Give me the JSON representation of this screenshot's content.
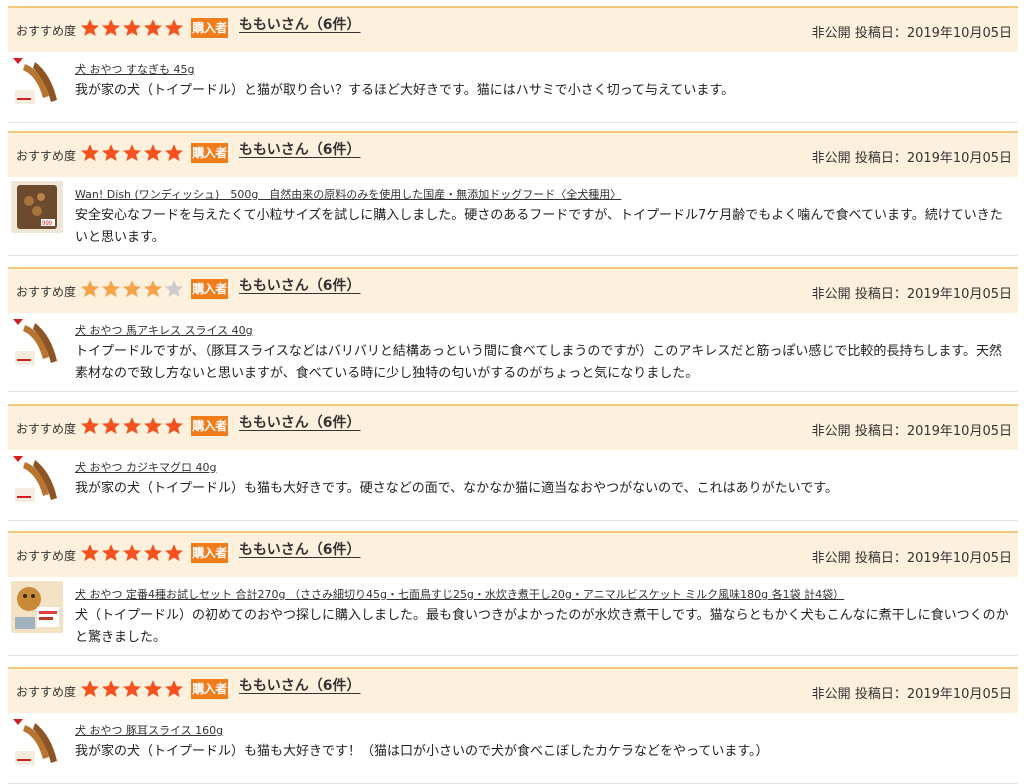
{
  "labels": {
    "recommend": "おすすめ度",
    "purchaser_badge": "購入者",
    "privacy": "非公開",
    "posted_prefix": "投稿日："
  },
  "colors": {
    "star_on": "#f4521e",
    "star_half": "#f5a24a",
    "star_off": "#cccccc",
    "badge": "#f07c1c",
    "header_bg": "#fdf0dc",
    "header_border": "#f2c87a"
  },
  "reviews": [
    {
      "rating": 5,
      "reviewer": "ももいさん（6件）",
      "date": "2019年10月05日",
      "product_icon": "jerky-product-icon",
      "product": "犬 おやつ すなぎも 45g",
      "comment": "我が家の犬（トイプードル）と猫が取り合い？するほど大好きです。猫にはハサミで小さく切って与えています。"
    },
    {
      "rating": 5,
      "reviewer": "ももいさん（6件）",
      "date": "2019年10月05日",
      "product_icon": "dog-food-bag-icon",
      "product": "Wan! Dish (ワンディッシュ)　500g　自然由来の原料のみを使用した国産・無添加ドッグフード〈全犬種用〉",
      "comment": "安全安心なフードを与えたくて小粒サイズを試しに購入しました。硬さのあるフードですが、トイプードル7ケ月齢でもよく噛んで食べています。続けていきたいと思います。"
    },
    {
      "rating": 4,
      "reviewer": "ももいさん（6件）",
      "date": "2019年10月05日",
      "product_icon": "jerky-product-icon",
      "product": "犬 おやつ 馬アキレス スライス 40g",
      "comment": "トイプードルですが、（豚耳スライスなどはバリバリと結構あっという間に食べてしまうのですが）このアキレスだと筋っぽい感じで比較的長持ちします。天然素材なので致し方ないと思いますが、食べている時に少し独特の匂いがするのがちょっと気になりました。"
    },
    {
      "rating": 5,
      "reviewer": "ももいさん（6件）",
      "date": "2019年10月05日",
      "product_icon": "jerky-product-icon",
      "product": "犬 おやつ カジキマグロ 40g",
      "comment": "我が家の犬（トイプードル）も猫も大好きです。硬さなどの面で、なかなか猫に適当なおやつがないので、これはありがたいです。"
    },
    {
      "rating": 5,
      "reviewer": "ももいさん（6件）",
      "date": "2019年10月05日",
      "product_icon": "dog-treat-set-icon",
      "product": "犬 おやつ 定番4種お試しセット 合計270g （ささみ細切り45g・七面鳥すじ25g・水炊き煮干し20g・アニマルビスケット ミルク風味180g 各1袋 計4袋）",
      "comment": "犬（トイプードル）の初めてのおやつ探しに購入しました。最も食いつきがよかったのが水炊き煮干しです。猫ならともかく犬もこんなに煮干しに食いつくのかと驚きました。"
    },
    {
      "rating": 5,
      "reviewer": "ももいさん（6件）",
      "date": "2019年10月05日",
      "product_icon": "jerky-product-icon",
      "product": "犬 おやつ 豚耳スライス 160g",
      "comment": "我が家の犬（トイプードル）も猫も大好きです！（猫は口が小さいので犬が食べこぼしたカケラなどをやっています。）"
    }
  ]
}
